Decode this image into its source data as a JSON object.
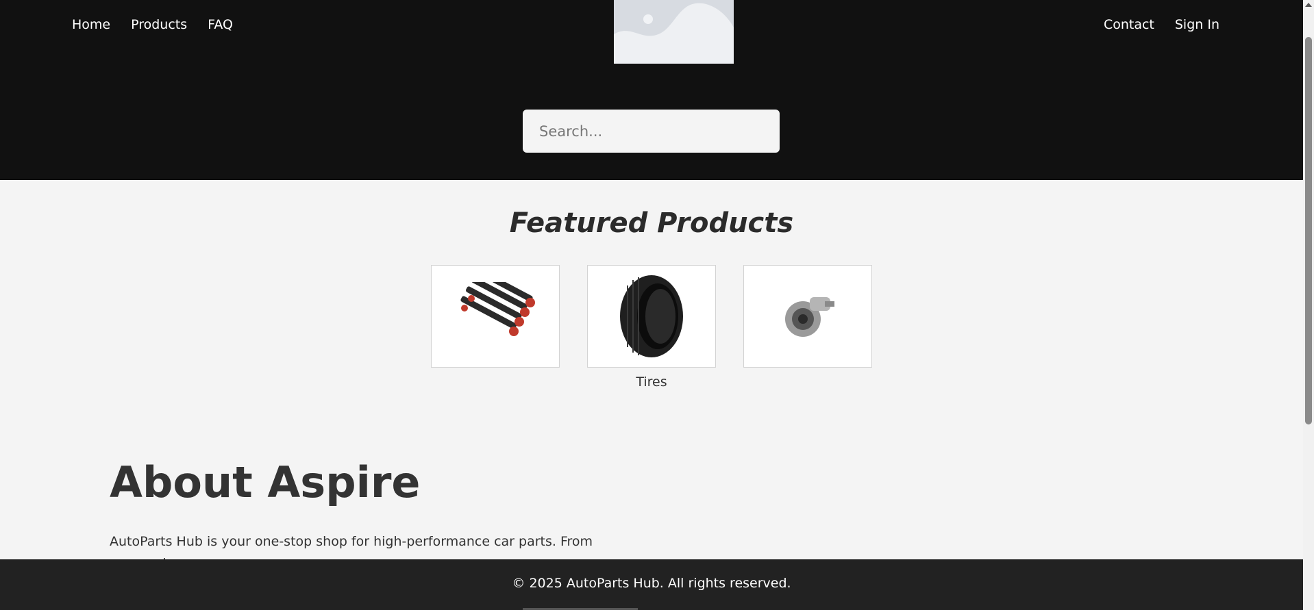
{
  "nav": {
    "left": [
      "Home",
      "Products",
      "FAQ"
    ],
    "right": [
      "Contact",
      "Sign In"
    ]
  },
  "logo": {
    "icon": "image-placeholder-icon"
  },
  "search": {
    "placeholder": "Search...",
    "value": ""
  },
  "featured": {
    "title": "Featured Products",
    "products": [
      {
        "label": "",
        "icon": "coilover-suspension-image"
      },
      {
        "label": "Tires",
        "icon": "tire-image"
      },
      {
        "label": "",
        "icon": "turbocharger-image"
      }
    ]
  },
  "about": {
    "title": "About Aspire",
    "text": "AutoParts Hub is your one-stop shop for high-performance car parts. From suspension"
  },
  "footer": {
    "text": "© 2025 AutoParts Hub. All rights reserved."
  },
  "colors": {
    "header_bg": "#111111",
    "page_bg": "#f4f4f4",
    "footer_bg": "#222222",
    "accent_red": "#c0392b"
  }
}
